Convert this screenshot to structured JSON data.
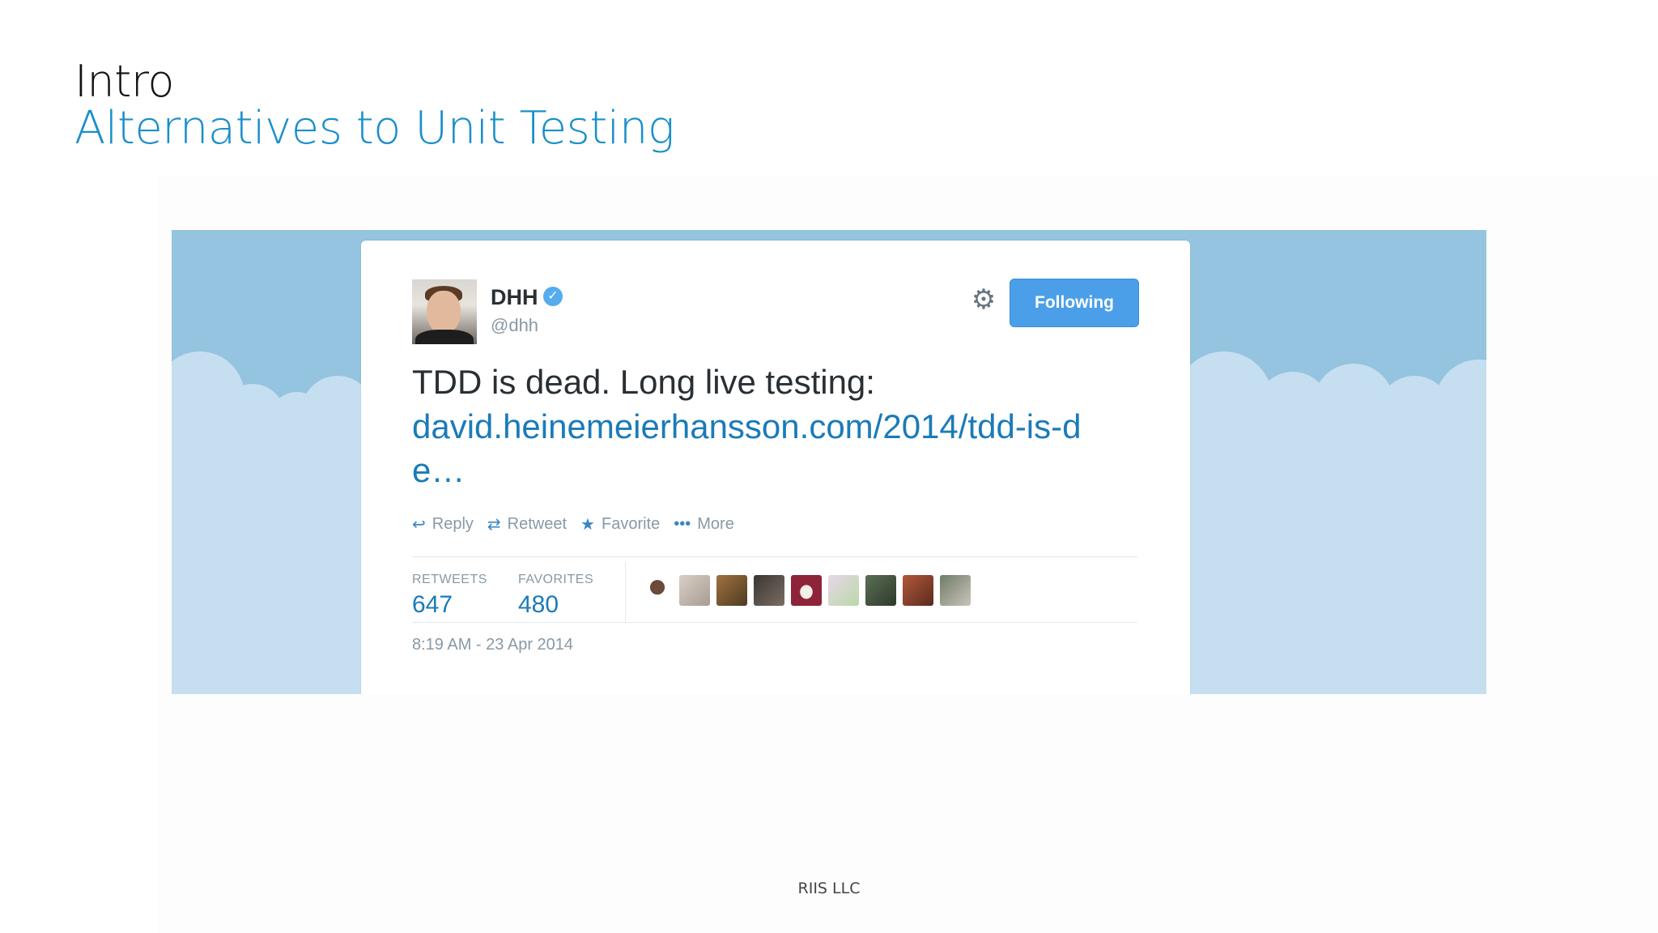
{
  "slide": {
    "title": "Intro",
    "subtitle": "Alternatives to Unit Testing",
    "footer": "RIIS LLC"
  },
  "tweet": {
    "author_name": "DHH",
    "handle": "@dhh",
    "verified_icon": "check-badge-icon",
    "follow_button": "Following",
    "text": "TDD is dead. Long live testing:",
    "link": "david.heinemeierhansson.com/2014/tdd-is-de…",
    "actions": {
      "reply": "Reply",
      "retweet": "Retweet",
      "favorite": "Favorite",
      "more": "More"
    },
    "stats": {
      "retweets_label": "RETWEETS",
      "retweets": "647",
      "favorites_label": "FAVORITES",
      "favorites": "480"
    },
    "timestamp": "8:19 AM - 23 Apr 2014"
  },
  "colors": {
    "accent": "#1a8fc9",
    "twitter_blue": "#4a9fe8",
    "link": "#1b7bb8",
    "sky": "#94c4df",
    "clouds": "#c5def0"
  }
}
